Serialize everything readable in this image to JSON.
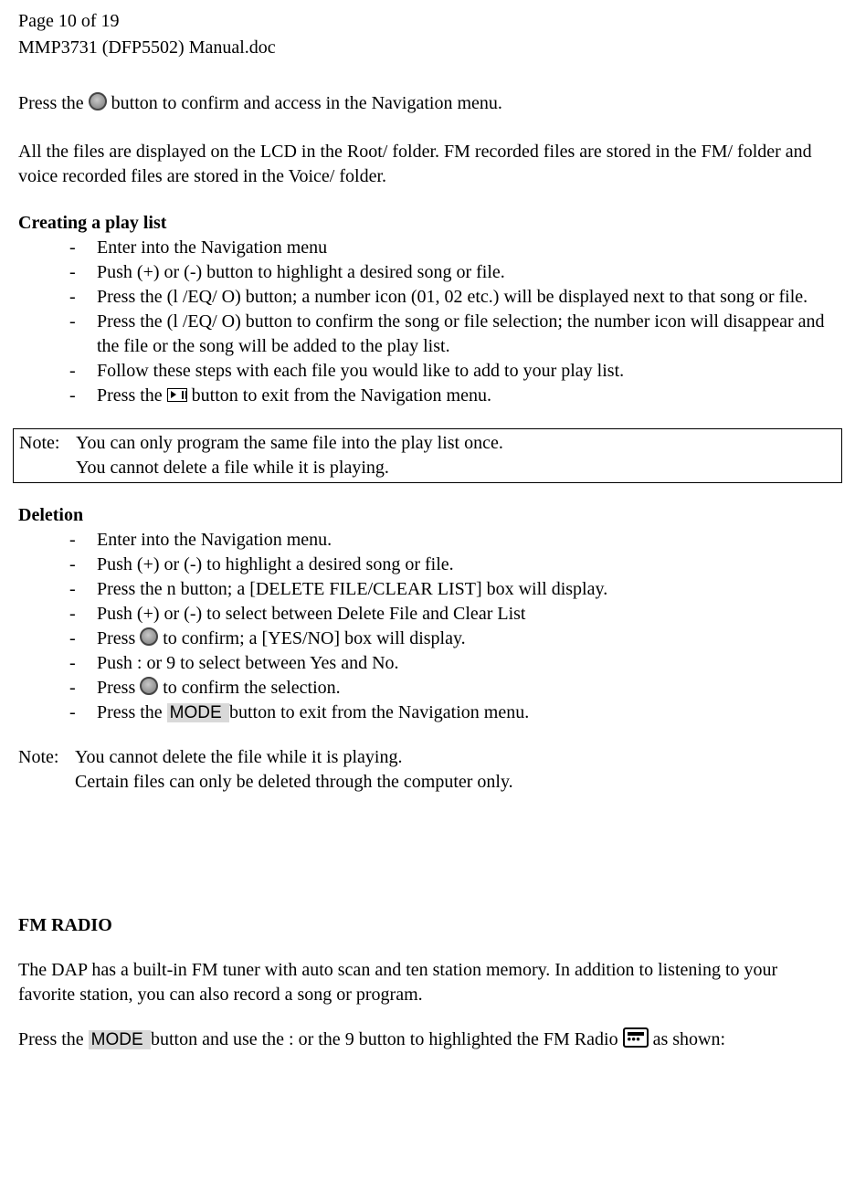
{
  "header": {
    "page_line": "Page 10 of 19",
    "doc_line": "MMP3731 (DFP5502) Manual.doc"
  },
  "intro": {
    "p1_a": "Press the ",
    "p1_b": " button to confirm and access in the Navigation menu.",
    "p2": "All the files are displayed on the LCD in the Root/ folder.  FM recorded files are stored in the FM/ folder and voice recorded files are stored in the Voice/ folder."
  },
  "playlist": {
    "heading": "Creating a play list",
    "items": [
      "Enter into the Navigation menu",
      "Push (+) or (-) button to highlight a desired song or file.",
      "Press the (l  /EQ/ O) button; a number icon (01, 02 etc.) will be displayed next to that song or file.",
      "Press the (l  /EQ/ O) button to confirm the song or file selection; the number icon will disappear and the file or the song will be added to the play list.",
      "Follow these steps with each file you would like to add to your play list."
    ],
    "last_a": "Press the ",
    "last_b": " button to exit from the Navigation menu."
  },
  "note1": {
    "label": "Note:",
    "line1": "You can only program the same file into the play list once.",
    "line2": "You cannot delete a file while it is playing."
  },
  "deletion": {
    "heading": "Deletion",
    "i0": "Enter into the Navigation menu.",
    "i1": "Push (+) or (-) to highlight a desired song or file.",
    "i2": "Press the n button; a [DELETE FILE/CLEAR LIST] box will display.",
    "i3": "Push (+) or (-) to select between Delete File and Clear List",
    "i4_a": "Press ",
    "i4_b": " to confirm; a [YES/NO] box will display.",
    "i5": "Push  :   or  9   to select between Yes and No.",
    "i6_a": "Press ",
    "i6_b": " to confirm the selection.",
    "i7_a": "Press the ",
    "i7_mode": " MODE ",
    "i7_b": " button to exit from the Navigation menu."
  },
  "note2": {
    "label": "Note:",
    "line1": "You cannot delete the file while it is playing.",
    "line2": "Certain files can only be deleted through the computer only."
  },
  "fm": {
    "heading": "FM RADIO",
    "p1": "The DAP has a built-in FM tuner with auto scan and ten station memory.  In addition to listening to your favorite station, you can also record a song or program.",
    "p2_a": "Press the ",
    "p2_mode": " MODE ",
    "p2_b": " button and use the :  or the 9  button to highlighted the FM Radio ",
    "p2_c": " as shown:"
  }
}
